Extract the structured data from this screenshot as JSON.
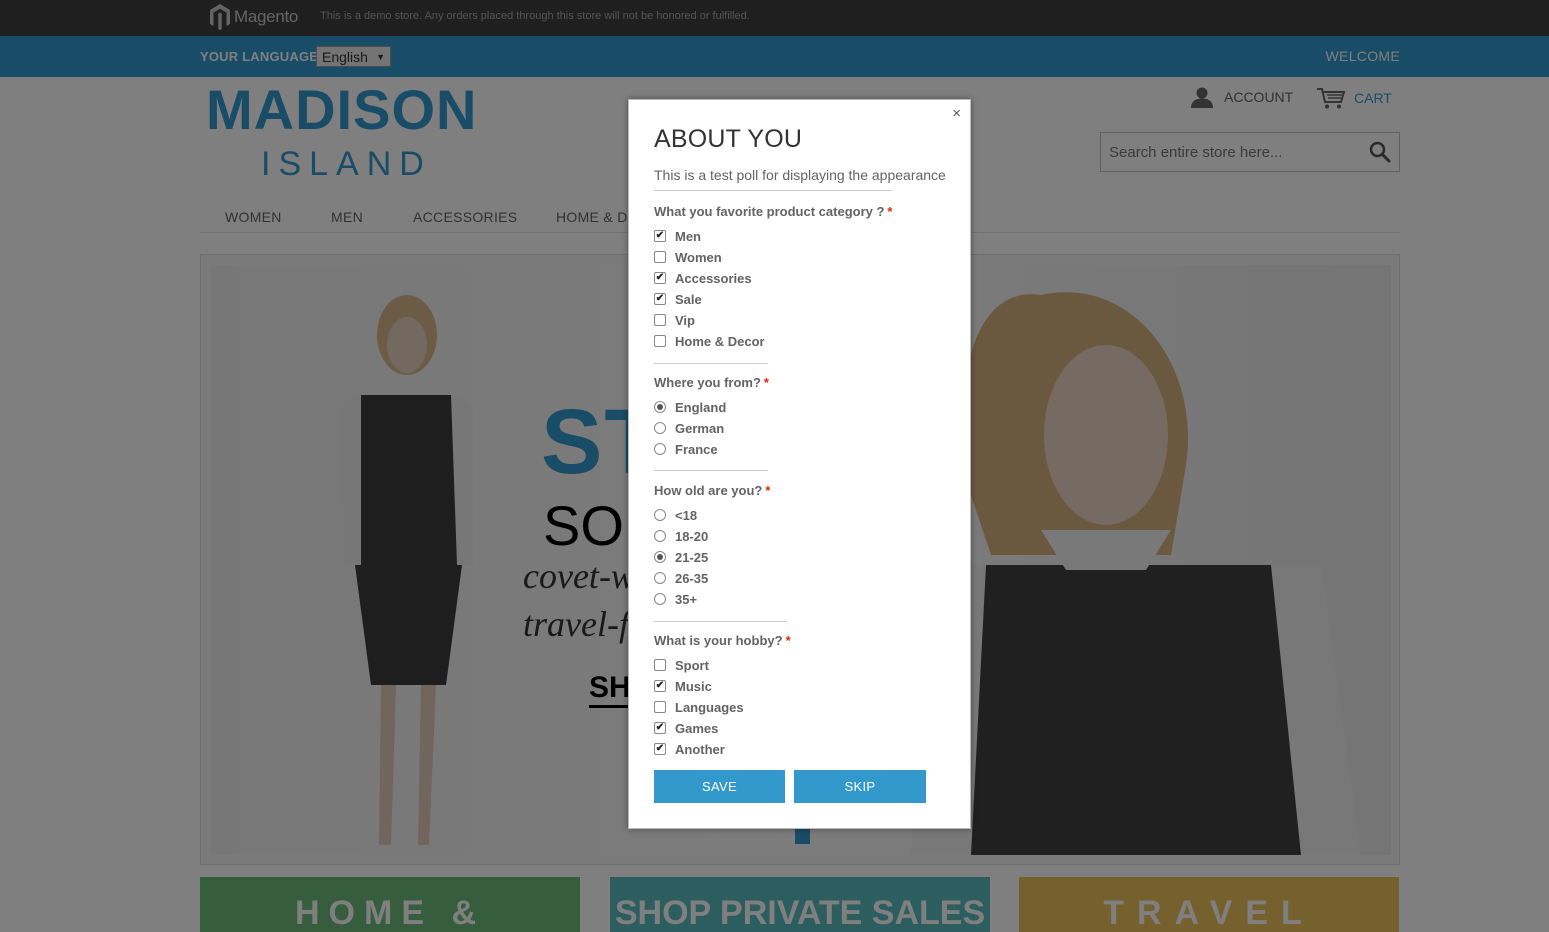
{
  "demo_bar": {
    "brand": "Magento",
    "notice": "This is a demo store. Any orders placed through this store will not be honored or fulfilled."
  },
  "lang_bar": {
    "label": "YOUR LANGUAGE",
    "selected": "English",
    "welcome": "WELCOME"
  },
  "header": {
    "logo_main": "MADISON",
    "logo_sub": "ISLAND",
    "account": "ACCOUNT",
    "cart": "CART",
    "search_placeholder": "Search entire store here..."
  },
  "nav": [
    "WOMEN",
    "MEN",
    "ACCESSORIES",
    "HOME & DECOR"
  ],
  "hero": {
    "line1": "ST",
    "line2": "SO",
    "line3": "covet-w",
    "line4": "travel-f",
    "cta": "SH"
  },
  "tiles": [
    {
      "label": "HOME & DECOR",
      "color": "#6cbd7c"
    },
    {
      "label": "SHOP PRIVATE SALES",
      "color": "#5bbcbf"
    },
    {
      "label": "TRAVEL GEAR",
      "color": "#e8c25b"
    }
  ],
  "colors": {
    "accent": "#3399cc",
    "required": "#df280a"
  },
  "modal": {
    "close": "×",
    "title": "ABOUT YOU",
    "description": "This is a test poll for displaying the appearance",
    "required_mark": "*",
    "questions": [
      {
        "text": "What you favorite product category ?",
        "type": "checkbox",
        "options": [
          {
            "label": "Men",
            "checked": true
          },
          {
            "label": "Women",
            "checked": false
          },
          {
            "label": "Accessories",
            "checked": true
          },
          {
            "label": "Sale",
            "checked": true
          },
          {
            "label": "Vip",
            "checked": false
          },
          {
            "label": "Home & Decor",
            "checked": false
          }
        ]
      },
      {
        "text": "Where you from?",
        "type": "radio",
        "options": [
          {
            "label": "England",
            "checked": true
          },
          {
            "label": "German",
            "checked": false
          },
          {
            "label": "France",
            "checked": false
          }
        ]
      },
      {
        "text": "How old are you?",
        "type": "radio",
        "options": [
          {
            "label": "<18",
            "checked": false
          },
          {
            "label": "18-20",
            "checked": false
          },
          {
            "label": "21-25",
            "checked": true
          },
          {
            "label": "26-35",
            "checked": false
          },
          {
            "label": "35+",
            "checked": false
          }
        ]
      },
      {
        "text": "What is your hobby?",
        "type": "checkbox",
        "options": [
          {
            "label": "Sport",
            "checked": false
          },
          {
            "label": "Music",
            "checked": true
          },
          {
            "label": "Languages",
            "checked": false
          },
          {
            "label": "Games",
            "checked": true
          },
          {
            "label": "Another",
            "checked": true
          }
        ]
      }
    ],
    "save_label": "SAVE",
    "skip_label": "SKIP"
  }
}
